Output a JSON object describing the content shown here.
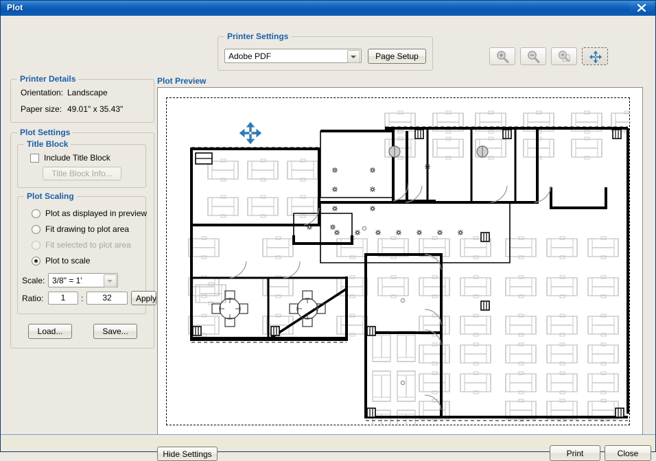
{
  "window": {
    "title": "Plot",
    "close_icon": "close-icon"
  },
  "printer_settings": {
    "legend": "Printer Settings",
    "printer_value": "Adobe PDF",
    "page_setup_label": "Page Setup"
  },
  "toolbar": {
    "buttons": [
      {
        "name": "zoom-in-icon",
        "label": "Zoom In",
        "enabled": false
      },
      {
        "name": "zoom-out-icon",
        "label": "Zoom Out",
        "enabled": false
      },
      {
        "name": "zoom-fit-icon",
        "label": "Zoom Fit",
        "enabled": false
      },
      {
        "name": "pan-icon",
        "label": "Pan",
        "enabled": true,
        "selected": true
      }
    ]
  },
  "printer_details": {
    "legend": "Printer Details",
    "orientation_label": "Orientation:",
    "orientation_value": "Landscape",
    "paper_size_label": "Paper size:",
    "paper_size_value": "49.01\" x 35.43\""
  },
  "plot_settings": {
    "legend": "Plot Settings",
    "title_block": {
      "legend": "Title Block",
      "include_label": "Include Title Block",
      "include_checked": false,
      "info_button_label": "Title Block Info...",
      "info_button_enabled": false
    },
    "plot_scaling": {
      "legend": "Plot Scaling",
      "options": [
        {
          "label": "Plot as displayed in preview",
          "selected": false,
          "enabled": true
        },
        {
          "label": "Fit drawing to plot area",
          "selected": false,
          "enabled": true
        },
        {
          "label": "Fit selected to plot area",
          "selected": false,
          "enabled": false
        },
        {
          "label": "Plot to scale",
          "selected": true,
          "enabled": true
        }
      ],
      "scale_label": "Scale:",
      "scale_value": "3/8\" = 1'",
      "ratio_label": "Ratio:",
      "ratio_numerator": "1",
      "ratio_separator": ":",
      "ratio_denominator": "32",
      "apply_label": "Apply"
    },
    "load_label": "Load...",
    "save_label": "Save..."
  },
  "plot_preview": {
    "legend": "Plot Preview",
    "cursor": "pan-cursor-icon"
  },
  "footer": {
    "hide_settings_label": "Hide Settings",
    "print_label": "Print",
    "close_label": "Close"
  },
  "colors": {
    "accent_blue": "#1a5fa8",
    "title_gradient_start": "#3f8fdc",
    "title_gradient_end": "#0a55ad",
    "dialog_bg": "#ece9e2",
    "pan_tool_blue": "#2f7ab5",
    "wall_black": "#000000",
    "furniture_gray": "#c9c9c9"
  }
}
